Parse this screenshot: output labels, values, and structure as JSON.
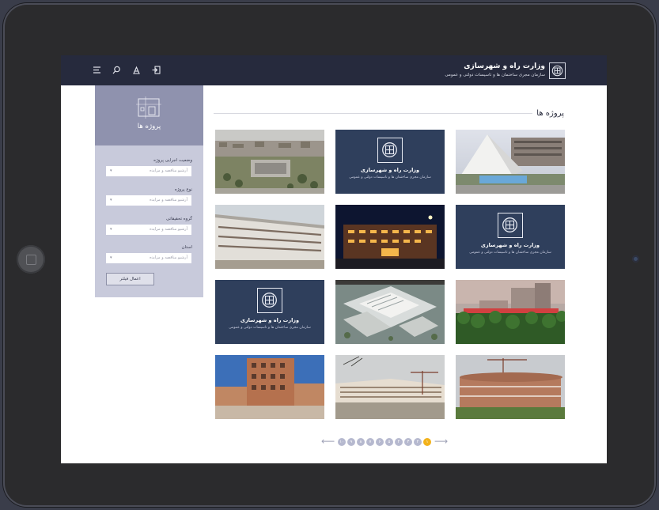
{
  "brand": {
    "title": "وزارت راه و شهرسازی",
    "subtitle": "سازمان مجری ساختمان ها و تاسیسات دولتی و عمومی"
  },
  "topbar_icons": [
    "menu-icon",
    "search-icon",
    "user-icon",
    "login-icon"
  ],
  "sidebar": {
    "title": "پروژه ها",
    "filters": [
      {
        "label": "وضعیت اجرایی پروژه",
        "placeholder": "آرشیو مناقصه و مزایده"
      },
      {
        "label": "نوع پروژه",
        "placeholder": "آرشیو مناقصه و مزایده"
      },
      {
        "label": "گروه تحقیقاتی",
        "placeholder": "آرشیو مناقصه و مزایده"
      },
      {
        "label": "استان",
        "placeholder": "آرشیو مناقصه و مزایده"
      }
    ],
    "apply_button": "اعمال فیلتر"
  },
  "main": {
    "section_title": "پروژه ها",
    "projects": [
      {
        "kind": "photo",
        "scene": "pyramid-building"
      },
      {
        "kind": "brand"
      },
      {
        "kind": "photo",
        "scene": "aerial-city"
      },
      {
        "kind": "brand"
      },
      {
        "kind": "photo",
        "scene": "night-building"
      },
      {
        "kind": "photo",
        "scene": "long-white-building"
      },
      {
        "kind": "photo",
        "scene": "industrial-trees"
      },
      {
        "kind": "photo",
        "scene": "model-complex"
      },
      {
        "kind": "brand"
      },
      {
        "kind": "photo",
        "scene": "round-building"
      },
      {
        "kind": "photo",
        "scene": "construction-site"
      },
      {
        "kind": "photo",
        "scene": "brick-building"
      }
    ]
  },
  "pagination": {
    "pages": [
      "۱",
      "۲",
      "۳",
      "۴",
      "۵",
      "۶",
      "۷",
      "۸",
      "۹",
      "۱۰"
    ],
    "active_page": "۱"
  },
  "colors": {
    "topbar": "#262a3d",
    "sidebar": "#c8cadb",
    "sidebar_head": "#8f92ae",
    "brand_card": "#2f3f5c",
    "pagination_active": "#f2b21b"
  }
}
